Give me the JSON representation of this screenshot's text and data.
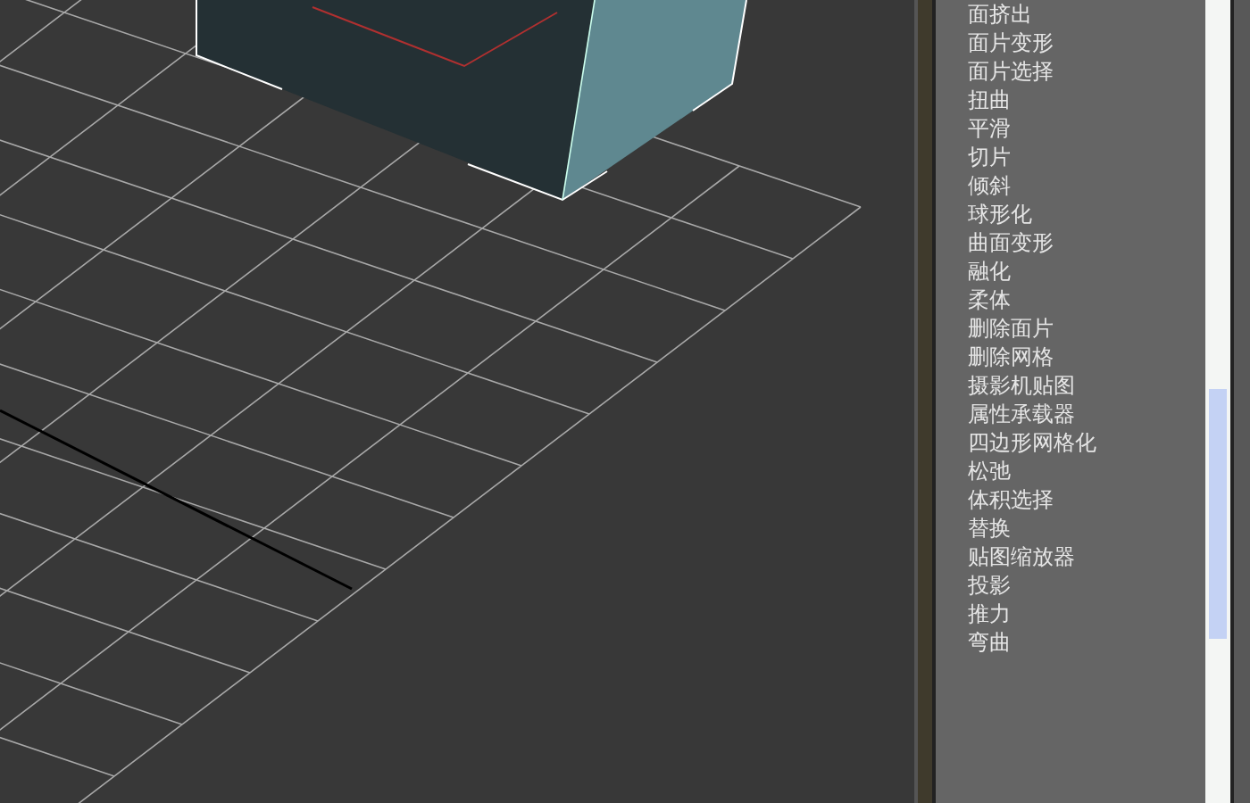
{
  "modifier_list": {
    "items": [
      "面挤出",
      "面片变形",
      "面片选择",
      "扭曲",
      "平滑",
      "切片",
      "倾斜",
      "球形化",
      "曲面变形",
      "融化",
      "柔体",
      "删除面片",
      "删除网格",
      "摄影机贴图",
      "属性承载器",
      "四边形网格化",
      "松弛",
      "体积选择",
      "替换",
      "贴图缩放器",
      "投影",
      "推力",
      "弯曲"
    ]
  }
}
